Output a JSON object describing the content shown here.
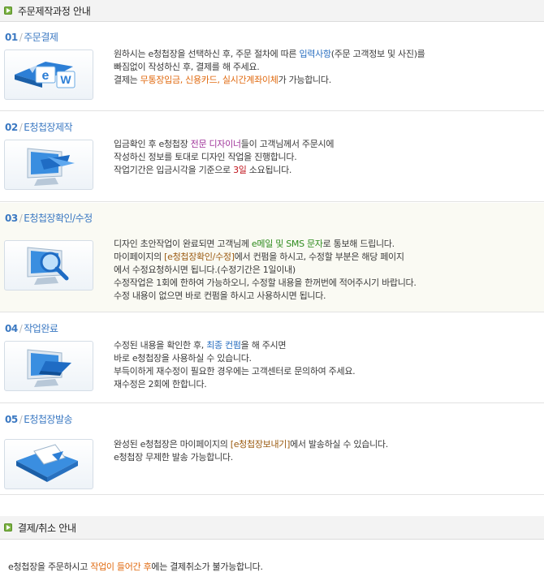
{
  "section1": {
    "title": "주문제작과정 안내"
  },
  "steps": [
    {
      "num": "01",
      "name": "주문결제",
      "lines": [
        [
          {
            "t": "원하시는 e청첩장을 선택하신 후, 주문 절차에 따른 "
          },
          {
            "t": "입력사항",
            "c": "blue"
          },
          {
            "t": "(주문 고객정보 및 사진)를"
          }
        ],
        [
          {
            "t": "빠짐없이 작성하신 후, 결제를 해 주세요."
          }
        ],
        [
          {
            "t": "결제는 "
          },
          {
            "t": "무통장입금, 신용카드, 실시간계좌이체",
            "c": "orange"
          },
          {
            "t": "가 가능합니다."
          }
        ]
      ]
    },
    {
      "num": "02",
      "name": "E청첩장제작",
      "lines": [
        [
          {
            "t": "입금확인 후 e청첩장 "
          },
          {
            "t": "전문 디자이너",
            "c": "purple"
          },
          {
            "t": "들이 고객님께서 주문시에"
          }
        ],
        [
          {
            "t": "작성하신 정보를 토대로 디자인 작업을 진행합니다."
          }
        ],
        [
          {
            "t": "작업기간은 입금시각을 기준으로 "
          },
          {
            "t": "3일",
            "c": "red"
          },
          {
            "t": " 소요됩니다."
          }
        ]
      ]
    },
    {
      "num": "03",
      "name": "E청첩장확인/수정",
      "lines": [
        [
          {
            "t": "디자인 초안작업이 완료되면 고객님께 "
          },
          {
            "t": "e메일 및 SMS 문자",
            "c": "green"
          },
          {
            "t": "로 통보해 드립니다."
          }
        ],
        [
          {
            "t": "마이페이지의 "
          },
          {
            "t": "[e청첩장확인/수정]",
            "c": "brown"
          },
          {
            "t": "에서 컨펌을 하시고, 수정할 부분은 해당 페이지"
          }
        ],
        [
          {
            "t": "에서 수정요청하시면 됩니다.(수정기간은 1일이내)"
          }
        ],
        [
          {
            "t": "수정작업은 1회에 한하여 가능하오니, 수정할 내용을 한꺼번에 적어주시기 바랍니다."
          }
        ],
        [
          {
            "t": "수정 내용이 없으면 바로 컨펌을 하시고 사용하시면 됩니다."
          }
        ]
      ]
    },
    {
      "num": "04",
      "name": "작업완료",
      "lines": [
        [
          {
            "t": "수정된 내용을 확인한 후, "
          },
          {
            "t": "최종 컨펌",
            "c": "blue"
          },
          {
            "t": "을 해 주시면"
          }
        ],
        [
          {
            "t": "바로 e청첩장을 사용하실 수 있습니다."
          }
        ],
        [
          {
            "t": "부득이하게 재수정이 필요한 경우에는 고객센터로 문의하여 주세요."
          }
        ],
        [
          {
            "t": "재수정은 2회에 한합니다."
          }
        ]
      ]
    },
    {
      "num": "05",
      "name": "E청첩장발송",
      "lines": [
        [
          {
            "t": "완성된 e청첩장은 마이페이지의 "
          },
          {
            "t": "[e청첩장보내기]",
            "c": "brown"
          },
          {
            "t": "에서 발송하실 수 있습니다."
          }
        ],
        [
          {
            "t": "e청첩장 무제한 발송 가능합니다."
          }
        ]
      ]
    }
  ],
  "section2": {
    "title": "결제/취소 안내"
  },
  "footer": [
    {
      "t": "e청첩장을 주문하시고 "
    },
    {
      "t": "작업이 들어간 후",
      "c": "orange"
    },
    {
      "t": "에는 결제취소가 불가능합니다."
    }
  ],
  "icons": [
    "web-order-icon",
    "monitor-design-icon",
    "monitor-search-icon",
    "monitor-complete-icon",
    "email-send-icon"
  ]
}
